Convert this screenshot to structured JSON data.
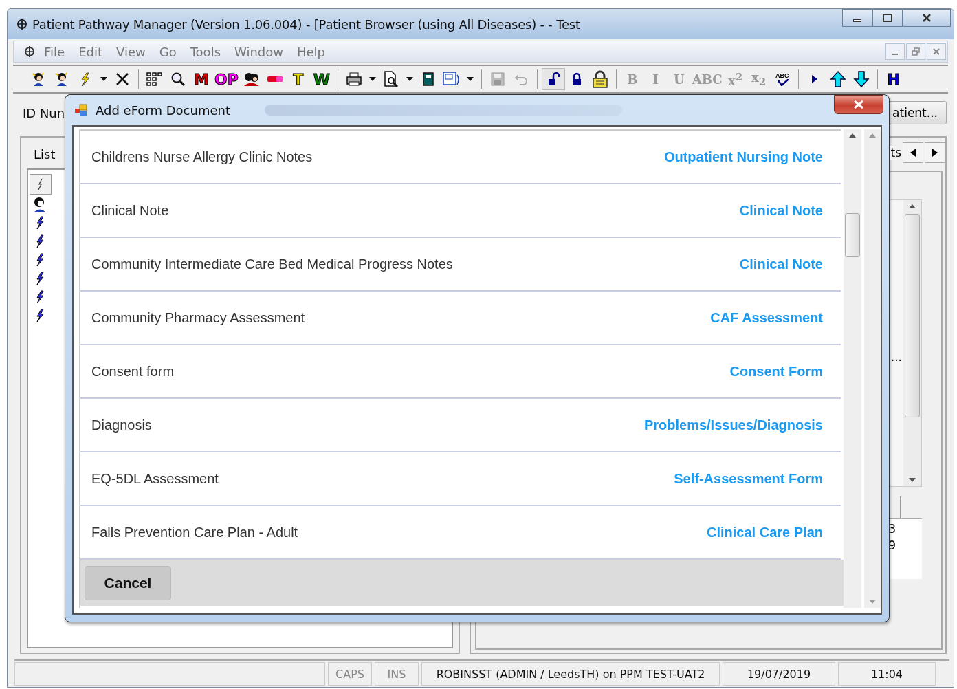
{
  "window": {
    "title": "Patient Pathway Manager (Version 1.06.004) - [Patient Browser (using All Diseases) -  - Test"
  },
  "menu": [
    "File",
    "Edit",
    "View",
    "Go",
    "Tools",
    "Window",
    "Help"
  ],
  "toolbar": [
    {
      "kind": "person"
    },
    {
      "kind": "person"
    },
    {
      "kind": "lightning"
    },
    {
      "kind": "dropdown"
    },
    {
      "kind": "cross"
    },
    {
      "kind": "separator"
    },
    {
      "kind": "grid"
    },
    {
      "kind": "magnifier"
    },
    {
      "kind": "letter",
      "label": "M",
      "color": "#e00000"
    },
    {
      "kind": "letter",
      "label": "OP",
      "color": "#ff00ff"
    },
    {
      "kind": "people"
    },
    {
      "kind": "pill"
    },
    {
      "kind": "letter",
      "label": "T",
      "color": "#e8d800"
    },
    {
      "kind": "letter",
      "label": "W",
      "color": "#008000"
    },
    {
      "kind": "separator"
    },
    {
      "kind": "printer"
    },
    {
      "kind": "dropdown"
    },
    {
      "kind": "preview"
    },
    {
      "kind": "dropdown"
    },
    {
      "kind": "book"
    },
    {
      "kind": "document"
    },
    {
      "kind": "dropdown"
    },
    {
      "kind": "separator"
    },
    {
      "kind": "save"
    },
    {
      "kind": "undo"
    },
    {
      "kind": "separator"
    },
    {
      "kind": "unlock"
    },
    {
      "kind": "lock"
    },
    {
      "kind": "padlock"
    },
    {
      "kind": "separator"
    },
    {
      "kind": "format",
      "label": "B"
    },
    {
      "kind": "format",
      "label": "I"
    },
    {
      "kind": "format",
      "label": "U"
    },
    {
      "kind": "format",
      "label": "ABC"
    },
    {
      "kind": "format",
      "label": "x$^{2}$"
    },
    {
      "kind": "format",
      "label": "x$_{2}$"
    },
    {
      "kind": "spellcheck",
      "label": "ABC"
    },
    {
      "kind": "separator"
    },
    {
      "kind": "play"
    },
    {
      "kind": "up"
    },
    {
      "kind": "down"
    },
    {
      "kind": "separator"
    },
    {
      "kind": "letter",
      "label": "H",
      "color": "#0000ee"
    }
  ],
  "id_label": "ID Nun",
  "patient_button": "atient...",
  "left_panel": {
    "tab": "List",
    "rows": [
      {
        "kind": "person"
      },
      {
        "kind": "lightning"
      },
      {
        "kind": "lightning"
      },
      {
        "kind": "lightning"
      },
      {
        "kind": "lightning"
      },
      {
        "kind": "lightning"
      },
      {
        "kind": "lightning"
      }
    ]
  },
  "right_panel": {
    "tab_fragment": "ts",
    "list_fragment": "...",
    "grid_cells": [
      "3",
      "9"
    ]
  },
  "dialog": {
    "title": "Add eForm Document",
    "rows": [
      {
        "name": "Childrens Nurse Allergy Clinic Notes",
        "category": "Outpatient Nursing Note"
      },
      {
        "name": "Clinical Note",
        "category": "Clinical Note"
      },
      {
        "name": "Community Intermediate Care Bed Medical Progress Notes",
        "category": "Clinical Note"
      },
      {
        "name": "Community Pharmacy Assessment",
        "category": "CAF Assessment"
      },
      {
        "name": "Consent form",
        "category": "Consent Form"
      },
      {
        "name": "Diagnosis",
        "category": "Problems/Issues/Diagnosis"
      },
      {
        "name": "EQ-5DL Assessment",
        "category": "Self-Assessment Form"
      },
      {
        "name": "Falls Prevention Care Plan - Adult",
        "category": "Clinical Care Plan"
      }
    ],
    "cancel": "Cancel"
  },
  "status_bar": {
    "caps": "CAPS",
    "ins": "INS",
    "user": "ROBINSST (ADMIN / LeedsTH) on PPM TEST-UAT2",
    "date": "19/07/2019",
    "time": "11:04"
  }
}
